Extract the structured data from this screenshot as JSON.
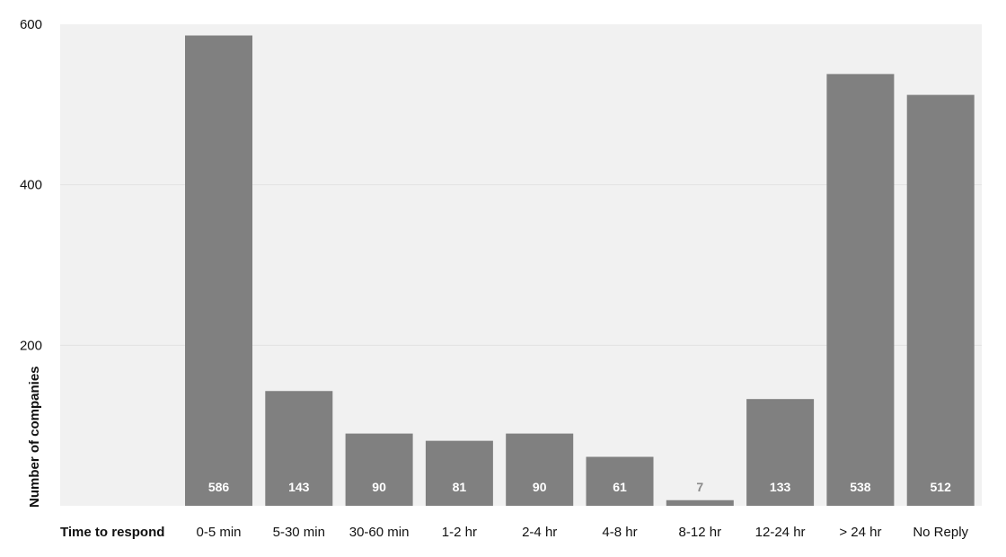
{
  "chart_data": {
    "type": "bar",
    "title": "",
    "xlabel": "Time to respond",
    "ylabel": "Number of companies",
    "categories": [
      "0-5 min",
      "5-30 min",
      "30-60 min",
      "1-2 hr",
      "2-4 hr",
      "4-8 hr",
      "8-12 hr",
      "12-24 hr",
      "> 24 hr",
      "No Reply"
    ],
    "values": [
      586,
      143,
      90,
      81,
      90,
      61,
      7,
      133,
      538,
      512
    ],
    "ylim": [
      0,
      600
    ],
    "yticks": [
      200,
      400,
      600
    ],
    "grid": true,
    "legend": "none",
    "colors": {
      "bar": "#808080",
      "plot_bg": "#f1f1f1",
      "grid": "#e2e2e2",
      "label_inside": "#ffffff",
      "label_outside": "#8a8a8a"
    }
  }
}
